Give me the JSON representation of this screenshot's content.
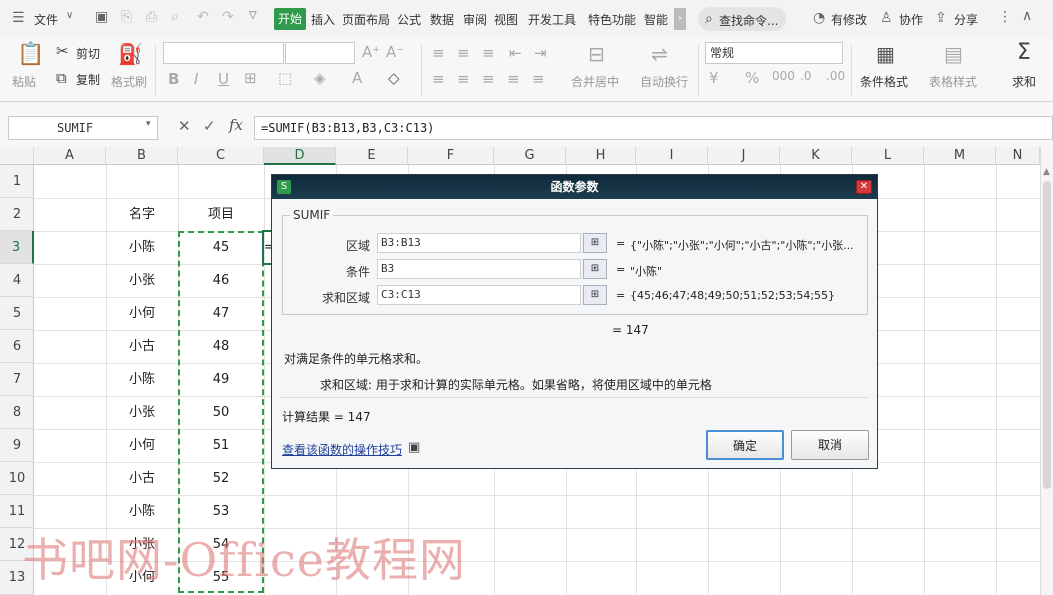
{
  "menu": {
    "file": "文件",
    "tabs": [
      "开始",
      "插入",
      "页面布局",
      "公式",
      "数据",
      "审阅",
      "视图",
      "开发工具",
      "特色功能",
      "智能"
    ],
    "search": "查找命令...",
    "edits": "有修改",
    "collab": "协作",
    "share": "分享"
  },
  "ribbon": {
    "paste": "粘贴",
    "cut": "剪切",
    "copy": "复制",
    "format_painter": "格式刷",
    "number_format": "常规",
    "merge_center": "合并居中",
    "wrap_text": "自动换行",
    "conditional_format": "条件格式",
    "table_style": "表格样式",
    "sum": "求和"
  },
  "formula_bar": {
    "name_box": "SUMIF",
    "fx": "fx",
    "formula": "=SUMIF(B3:B13,B3,C3:C13)"
  },
  "grid": {
    "columns": [
      "A",
      "B",
      "C",
      "D",
      "E",
      "F",
      "G",
      "H",
      "I",
      "J",
      "K",
      "L",
      "M",
      "N"
    ],
    "rows": [
      "1",
      "2",
      "3",
      "4",
      "5",
      "6",
      "7",
      "8",
      "9",
      "10",
      "11",
      "12",
      "13"
    ],
    "header_b": "名字",
    "header_c": "项目",
    "names": [
      "小陈",
      "小张",
      "小何",
      "小古",
      "小陈",
      "小张",
      "小何",
      "小古",
      "小陈",
      "小张",
      "小何"
    ],
    "values": [
      "45",
      "46",
      "47",
      "48",
      "49",
      "50",
      "51",
      "52",
      "53",
      "54",
      "55"
    ],
    "d3_partial": "="
  },
  "dialog": {
    "title": "函数参数",
    "function_name": "SUMIF",
    "params": [
      {
        "label": "区域",
        "value": "B3:B13",
        "result": "{\"小陈\";\"小张\";\"小何\";\"小古\";\"小陈\";\"小张..."
      },
      {
        "label": "条件",
        "value": "B3",
        "result": "\"小陈\""
      },
      {
        "label": "求和区域",
        "value": "C3:C13",
        "result": "{45;46;47;48;49;50;51;52;53;54;55}"
      }
    ],
    "eq": "=",
    "formula_result": "= 147",
    "description": "对满足条件的单元格求和。",
    "param_desc": "求和区域:  用于求和计算的实际单元格。如果省略，将使用区域中的单元格",
    "calc_result": "计算结果 = 147",
    "help_link": "查看该函数的操作技巧",
    "ok": "确定",
    "cancel": "取消"
  },
  "watermark": "书吧网-Office教程网"
}
